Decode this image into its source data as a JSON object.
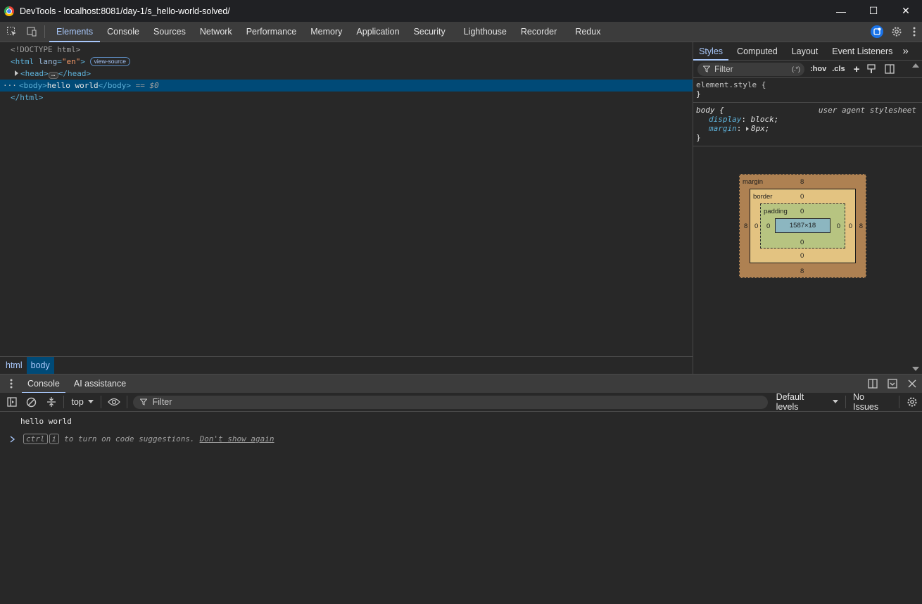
{
  "window": {
    "title": "DevTools - localhost:8081/day-1/s_hello-world-solved/",
    "minimize": "—",
    "maximize": "☐",
    "close": "✕"
  },
  "toolbar": {
    "tabs": [
      "Elements",
      "Console",
      "Sources",
      "Network",
      "Performance",
      "Memory",
      "Application",
      "Security",
      "Lighthouse",
      "Recorder",
      "Redux"
    ],
    "active_tab": "Elements"
  },
  "dom": {
    "doctype": "<!DOCTYPE html>",
    "html_open_tag": "<html",
    "html_attr_name": "lang",
    "html_attr_value": "\"en\"",
    "html_open_end": ">",
    "view_source_badge": "view-source",
    "head_open": "<head>",
    "head_ellipsis": "…",
    "head_close": "</head>",
    "body_open": "<body>",
    "body_text": "hello world",
    "body_close": "</body>",
    "selected_marker": "== $0",
    "row_dots": "···",
    "html_close": "</html>"
  },
  "breadcrumbs": [
    "html",
    "body"
  ],
  "styles": {
    "tabs": [
      "Styles",
      "Computed",
      "Layout",
      "Event Listeners"
    ],
    "more": "»",
    "filter_placeholder": "Filter",
    "regex_label": "(.*)",
    "hov_label": ":hov",
    "cls_label": ".cls",
    "element_style_selector": "element.style {",
    "close_brace": "}",
    "body_selector": "body {",
    "ua_label": "user agent stylesheet",
    "props": [
      {
        "name": "display",
        "value": "block;"
      },
      {
        "name": "margin",
        "value": "8px;"
      }
    ]
  },
  "box_model": {
    "margin_label": "margin",
    "border_label": "border",
    "padding_label": "padding",
    "margin": {
      "top": "8",
      "right": "8",
      "bottom": "8",
      "left": "8"
    },
    "border": {
      "top": "0",
      "right": "0",
      "bottom": "0",
      "left": "0"
    },
    "padding": {
      "top": "0",
      "right": "0",
      "bottom": "0",
      "left": "0"
    },
    "content": "1587×18"
  },
  "drawer": {
    "tabs": [
      "Console",
      "AI assistance"
    ],
    "active_tab": "Console"
  },
  "console": {
    "context": "top",
    "filter_placeholder": "Filter",
    "levels": "Default levels",
    "issues": "No Issues",
    "log_text": "hello world",
    "hint_kbd1": "ctrl",
    "hint_kbd2": "i",
    "hint_text": "to turn on code suggestions.",
    "hint_link": "Don't show again"
  }
}
